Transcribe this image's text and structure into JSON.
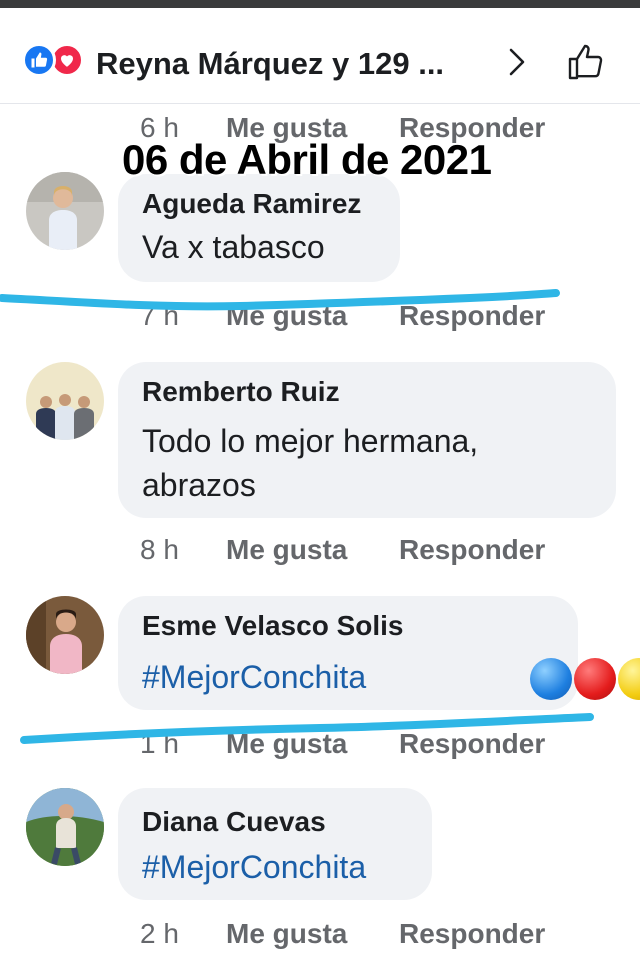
{
  "header": {
    "title": "Reyna Márquez y 129 ...",
    "reactions": [
      "like-icon",
      "love-icon"
    ],
    "colors": {
      "like": "#1877f2",
      "love": "#f0284a"
    }
  },
  "overlay": {
    "date": "06 de Abril de 2021"
  },
  "top_meta": {
    "time": "6 h",
    "like": "Me gusta",
    "reply": "Responder"
  },
  "comments": [
    {
      "name": "Agueda Ramirez",
      "text": "Va x tabasco",
      "time": "7 h",
      "like": "Me gusta",
      "reply": "Responder"
    },
    {
      "name": "Remberto Ruiz",
      "text_line1": "Todo lo mejor hermana,",
      "text_line2": "abrazos",
      "time": "8 h",
      "like": "Me gusta",
      "reply": "Responder"
    },
    {
      "name": "Esme Velasco Solis",
      "text": "#MejorConchita",
      "time": "1 h",
      "like": "Me gusta",
      "reply": "Responder"
    },
    {
      "name": "Diana Cuevas",
      "text": "#MejorConchita",
      "time": "2 h",
      "like": "Me gusta",
      "reply": "Responder"
    }
  ],
  "colors": {
    "hashtag": "#1b5fa8",
    "meta": "#65676b",
    "bubble": "#f0f2f5",
    "marker": "#2fb6e6"
  }
}
